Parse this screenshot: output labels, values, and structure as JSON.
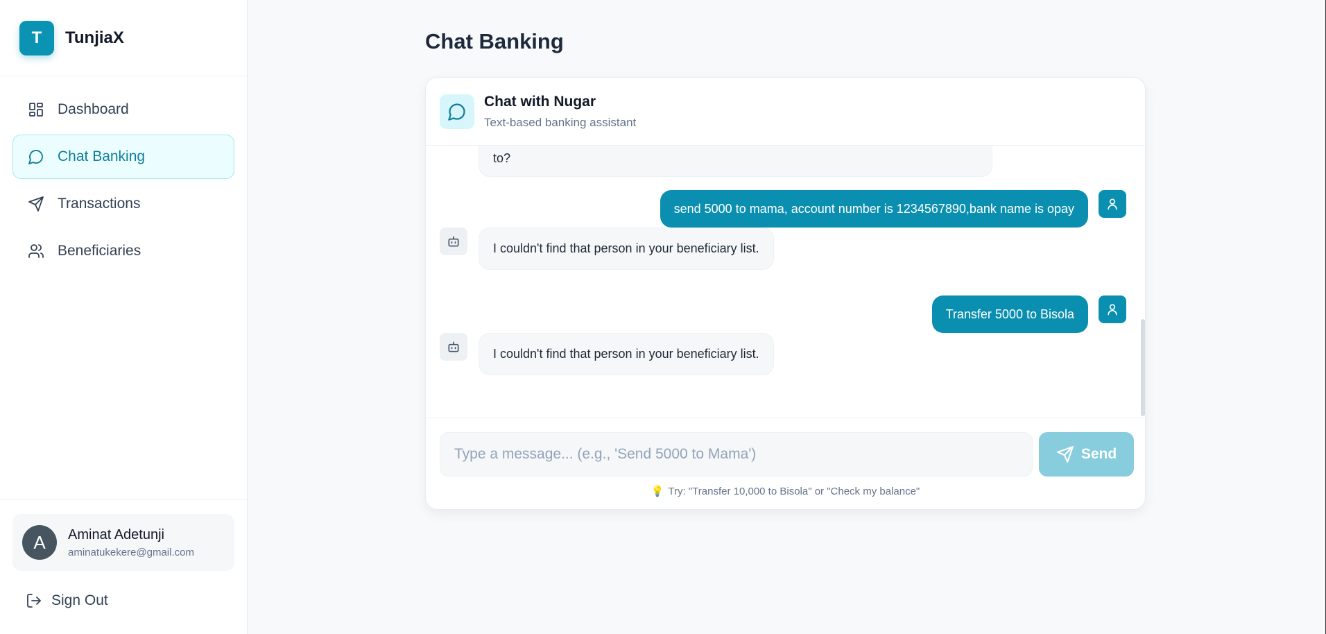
{
  "brand": {
    "logo_letter": "T",
    "name": "TunjiaX"
  },
  "nav": {
    "items": [
      {
        "label": "Dashboard",
        "icon": "dashboard-icon"
      },
      {
        "label": "Chat Banking",
        "icon": "chat-icon",
        "active": true
      },
      {
        "label": "Transactions",
        "icon": "send-icon"
      },
      {
        "label": "Beneficiaries",
        "icon": "users-icon"
      }
    ]
  },
  "user": {
    "initial": "A",
    "name": "Aminat Adetunji",
    "email": "aminatukekere@gmail.com"
  },
  "signout": {
    "label": "Sign Out"
  },
  "page": {
    "title": "Chat Banking"
  },
  "chat": {
    "title": "Chat with Nugar",
    "subtitle": "Text-based banking assistant",
    "messages": [
      {
        "sender": "bot",
        "text": "to?"
      },
      {
        "sender": "user",
        "text": "send 5000 to mama, account number is 1234567890,bank name is opay"
      },
      {
        "sender": "bot",
        "text": "I couldn't find that person in your beneficiary list."
      },
      {
        "sender": "user",
        "text": "Transfer 5000 to Bisola"
      },
      {
        "sender": "bot",
        "text": "I couldn't find that person in your beneficiary list."
      }
    ],
    "input_placeholder": "Type a message... (e.g., 'Send 5000 to Mama')",
    "send_label": "Send",
    "hint": "Try: \"Transfer 10,000 to Bisola\" or \"Check my balance\""
  },
  "colors": {
    "accent": "#0b8fb0",
    "active_nav_bg": "#ecfdff",
    "send_disabled": "#88cddd"
  }
}
